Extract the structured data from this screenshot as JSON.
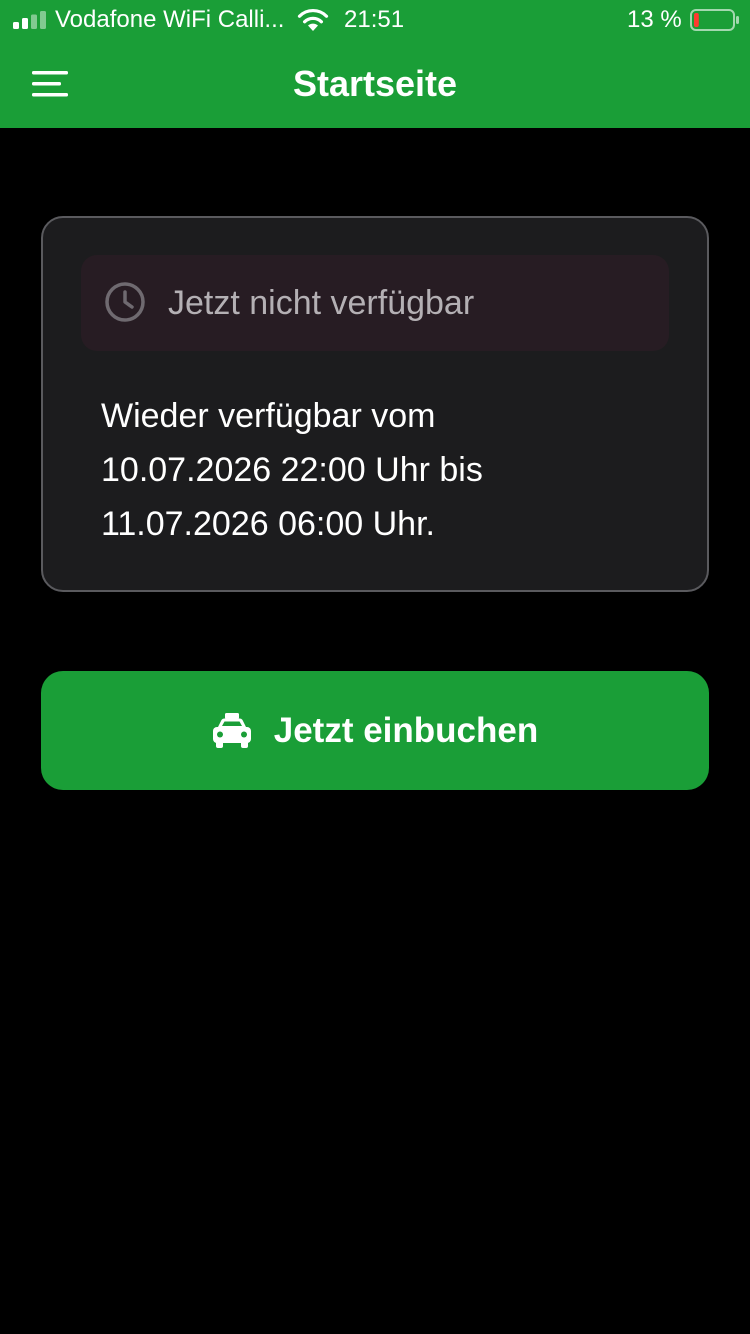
{
  "status_bar": {
    "carrier": "Vodafone WiFi Calli...",
    "time": "21:51",
    "battery_percent": "13 %",
    "battery_level": 0.13,
    "signal_bars_filled": 2,
    "signal_bars_total": 4,
    "icons": [
      "signal-icon",
      "wifi-icon",
      "battery-icon"
    ]
  },
  "header": {
    "title": "Startseite",
    "menu_icon": "hamburger-menu-icon"
  },
  "card": {
    "notice": {
      "icon": "clock-icon",
      "text": "Jetzt nicht verfügbar"
    },
    "info_lines": [
      "Wieder verfügbar vom",
      "10.07.2026 22:00 Uhr bis",
      "11.07.2026 06:00 Uhr."
    ]
  },
  "book_button": {
    "icon": "taxi-icon",
    "label": "Jetzt einbuchen"
  },
  "colors": {
    "brand_green": "#1a9e37",
    "background": "#000000",
    "card_background": "#1c1c1e",
    "card_border": "#5a5a5e",
    "notice_background": "#271c23",
    "notice_text": "#b4b0b4",
    "battery_low": "#ff3b30"
  }
}
